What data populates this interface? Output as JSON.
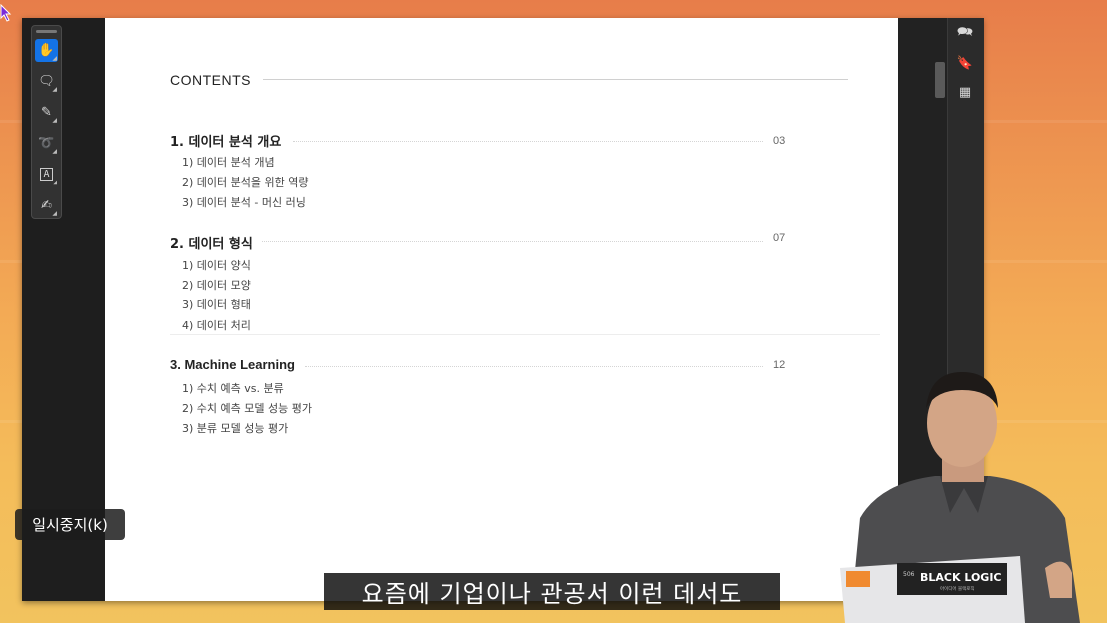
{
  "tools": [
    {
      "name": "hand-icon",
      "glyph": "✋",
      "active": true
    },
    {
      "name": "comment-add-icon",
      "glyph": "🗨",
      "active": false
    },
    {
      "name": "pen-icon",
      "glyph": "✎",
      "active": false
    },
    {
      "name": "lasso-icon",
      "glyph": "➰",
      "active": false
    },
    {
      "name": "text-box-icon",
      "glyph": "A",
      "active": false
    },
    {
      "name": "sign-icon",
      "glyph": "✍",
      "active": false
    }
  ],
  "right_rail": [
    {
      "name": "comments-icon",
      "glyph": "🗪"
    },
    {
      "name": "bookmark-icon",
      "glyph": "🔖"
    },
    {
      "name": "thumbnails-icon",
      "glyph": "▦"
    }
  ],
  "document": {
    "contents_title": "CONTENTS",
    "sections": [
      {
        "title": "1. 데이터 분석 개요",
        "page": "03",
        "items": [
          "1) 데이터 분석 개념",
          "2) 데이터 분석을 위한 역량",
          "3) 데이터 분석 - 머신 러닝"
        ]
      },
      {
        "title": "2. 데이터 형식",
        "page": "07",
        "items": [
          "1) 데이터 양식",
          "2) 데이터 모양",
          "3) 데이터 형태",
          "4) 데이터 처리"
        ]
      },
      {
        "title": "3. Machine Learning",
        "page": "12",
        "items": [
          "1)  수치 예측 vs. 분류",
          "2)  수치 예측 모델 성능 평가",
          "3)  분류 모델 성능 평가"
        ]
      }
    ]
  },
  "player": {
    "pause_tooltip": "일시중지(k)",
    "subtitle": "요즘에 기업이나 관공서 이런 데서도"
  },
  "webcam": {
    "laptop_sticker_number": "506",
    "laptop_sticker_title": "BLACK LOGIC",
    "laptop_sticker_sub": "아이디어 블랙로직"
  },
  "colors": {
    "accent": "#1473e6",
    "page_bg": "#ffffff",
    "viewer_bg": "#2a2a2a"
  }
}
